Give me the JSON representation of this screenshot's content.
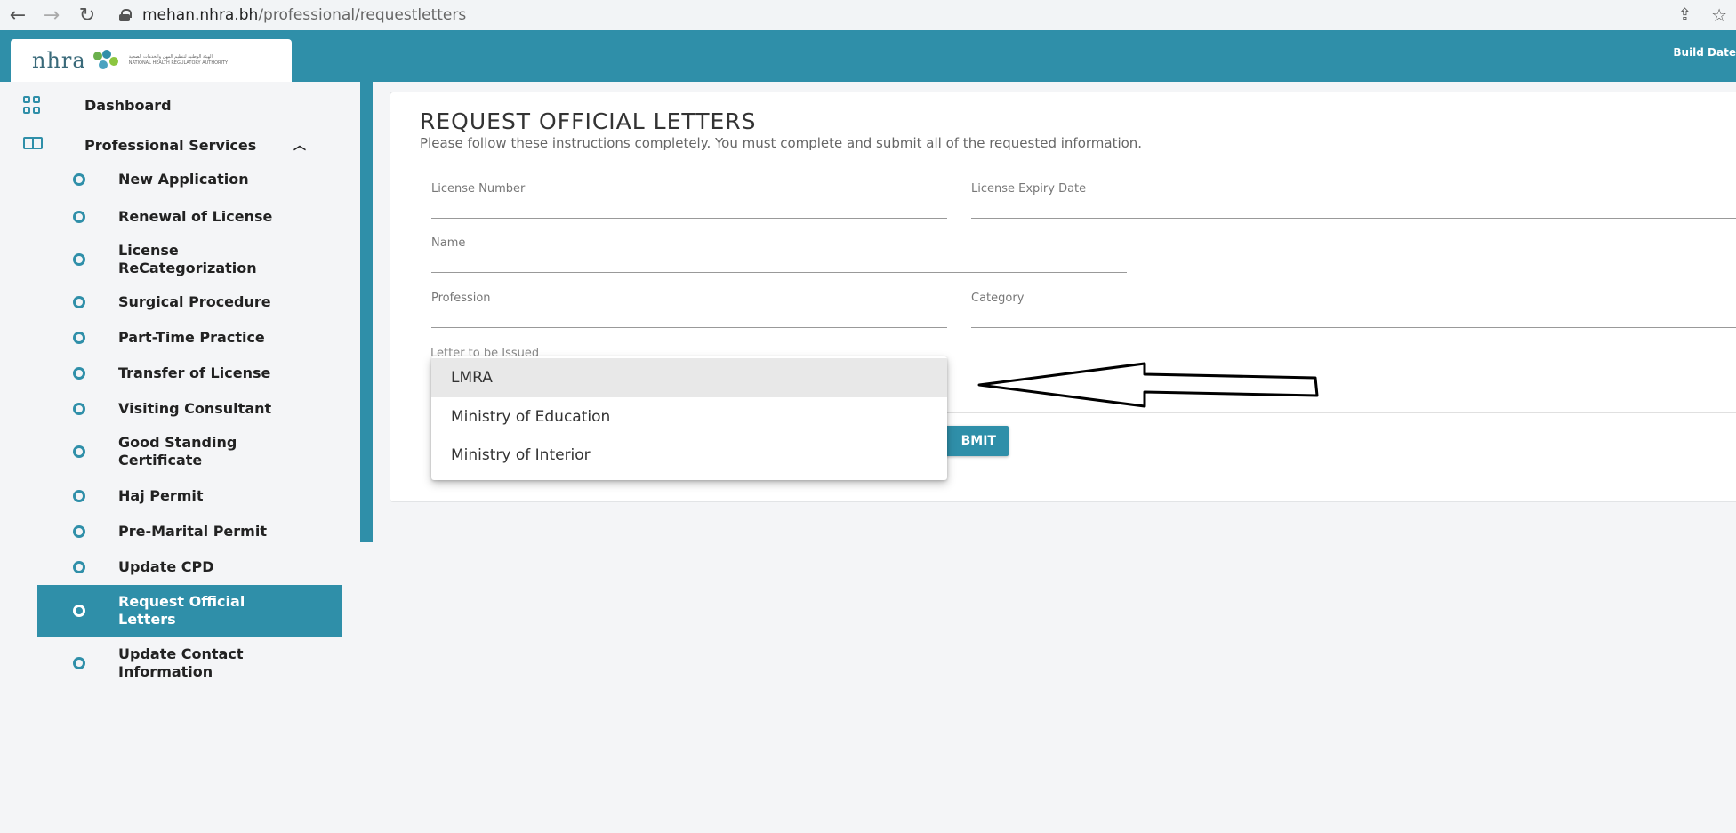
{
  "browser": {
    "url_host": "mehan.nhra.bh",
    "url_path": "/professional/requestletters"
  },
  "header": {
    "logo_text": "nhra",
    "logo_sub_line1": "الهيئة الوطنية لتنظيم المهن والخدمات الصحية",
    "logo_sub_line2": "NATIONAL HEALTH REGULATORY AUTHORITY",
    "build_date_label": "Build Date"
  },
  "sidebar": {
    "dashboard": "Dashboard",
    "professional_services": "Professional Services",
    "items": [
      {
        "label": "New Application"
      },
      {
        "label": "Renewal of License"
      },
      {
        "label": "License ReCategorization"
      },
      {
        "label": "Surgical Procedure"
      },
      {
        "label": "Part-Time Practice"
      },
      {
        "label": "Transfer of License"
      },
      {
        "label": "Visiting Consultant"
      },
      {
        "label": "Good Standing Certificate"
      },
      {
        "label": "Haj Permit"
      },
      {
        "label": "Pre-Marital Permit"
      },
      {
        "label": "Update CPD"
      },
      {
        "label": "Request Official Letters",
        "active": true
      },
      {
        "label": "Update Contact Information"
      }
    ]
  },
  "main": {
    "title": "REQUEST OFFICIAL LETTERS",
    "subtitle": "Please follow these instructions completely. You must complete and submit all of the requested information.",
    "fields": {
      "license_number": "License Number",
      "license_expiry": "License Expiry Date",
      "name": "Name",
      "profession": "Profession",
      "category": "Category",
      "letter": "Letter to be Issued"
    },
    "submit_label": "BMIT"
  },
  "dropdown": {
    "options": [
      "LMRA",
      "Ministry of Education",
      "Ministry of Interior"
    ]
  },
  "colors": {
    "brand": "#2f8fa9"
  }
}
